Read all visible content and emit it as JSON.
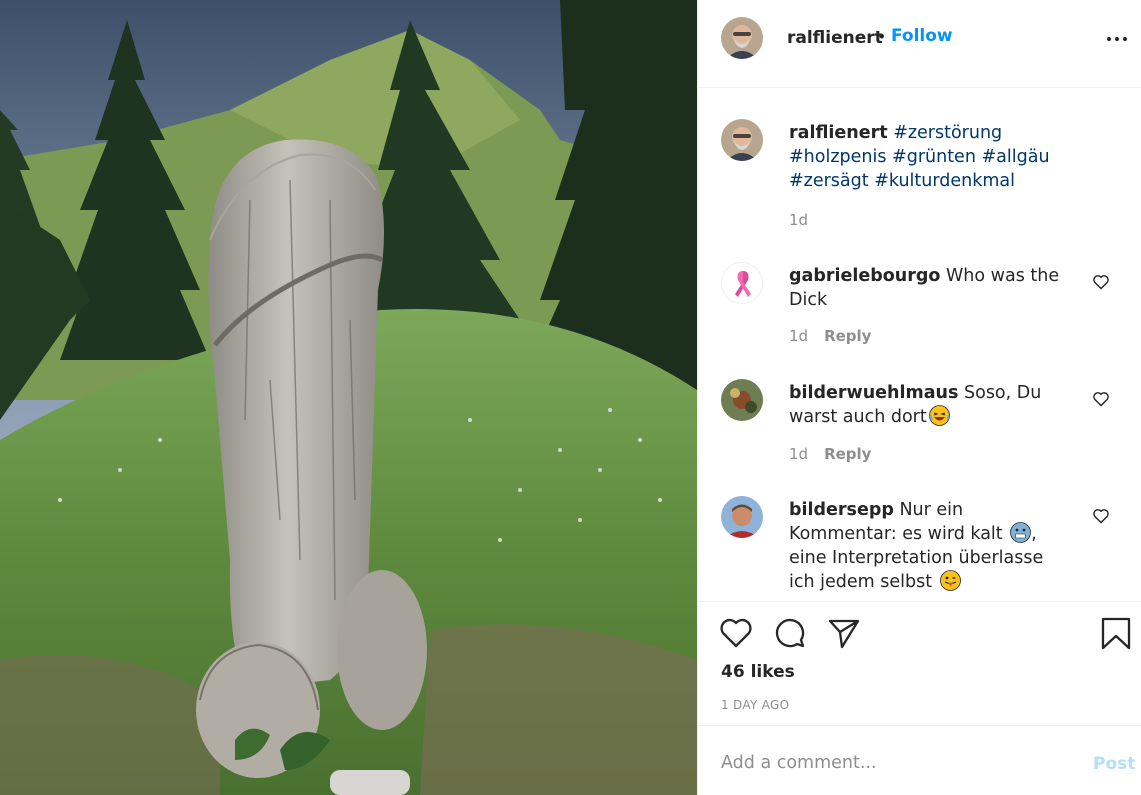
{
  "post": {
    "image_alt": "Carved wooden sculpture on a grassy mountain ridge",
    "author": {
      "username": "ralflienert",
      "separator": "•",
      "follow_label": "Follow"
    },
    "caption": {
      "username": "ralflienert",
      "hashtags": [
        "#zerstörung",
        "#holzpenis",
        "#grünten",
        "#allgäu",
        "#zersägt",
        "#kulturdenkmal"
      ],
      "time": "1d"
    },
    "comments": [
      {
        "username": "gabrielebourgo",
        "text": "Who was the Dick",
        "time": "1d",
        "reply_label": "Reply",
        "avatar_icon": "pink-ribbon-icon"
      },
      {
        "username": "bilderwuehlmaus",
        "text_before": "Soso, Du warst auch dort",
        "emoji_1": "laughing-emoji-icon",
        "time": "1d",
        "reply_label": "Reply"
      },
      {
        "username": "bildersepp",
        "text_before": "Nur ein Kommentar: es wird kalt",
        "emoji_1": "cold-face-emoji-icon",
        "text_after": ", eine Interpretation überlasse ich jedem selbst",
        "emoji_2": "tongue-out-emoji-icon"
      }
    ],
    "likes": "46 likes",
    "time_ago": "1 DAY AGO",
    "add_comment": {
      "placeholder": "Add a comment...",
      "post_label": "Post"
    },
    "colors": {
      "follow": "#0095f6",
      "hashtag": "#00376b",
      "muted": "#8e8e8e",
      "post_disabled": "#b2dffc"
    }
  }
}
